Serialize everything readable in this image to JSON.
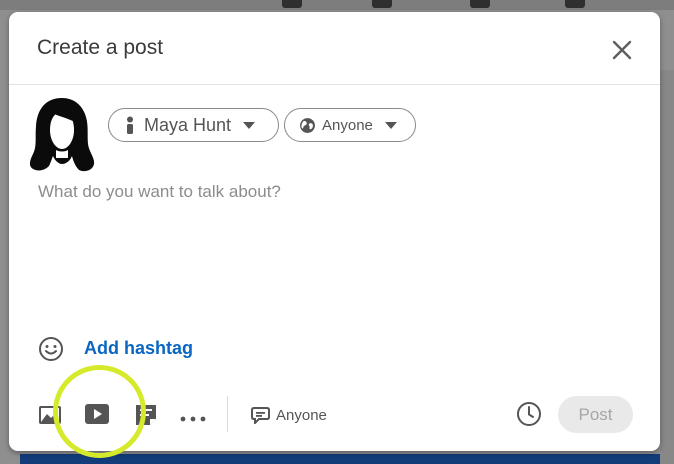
{
  "modal": {
    "title": "Create a post",
    "close_icon": "close-icon"
  },
  "author": {
    "name": "Maya Hunt",
    "icon": "person-icon"
  },
  "audience": {
    "label": "Anyone",
    "icon": "globe-icon"
  },
  "composer": {
    "placeholder": "What do you want to talk about?",
    "value": ""
  },
  "hashtag": {
    "label": "Add hashtag"
  },
  "toolbar": {
    "icons": [
      "photo-icon",
      "video-icon",
      "document-icon",
      "more-icon"
    ],
    "comment_scope": "Anyone",
    "comment_icon": "comment-icon",
    "schedule_icon": "clock-icon",
    "post_label": "Post"
  },
  "colors": {
    "accent": "#0a66c2",
    "highlight": "#d6ea2c",
    "post_disabled_bg": "#e9e9e9",
    "post_disabled_text": "#a6a6a6"
  }
}
